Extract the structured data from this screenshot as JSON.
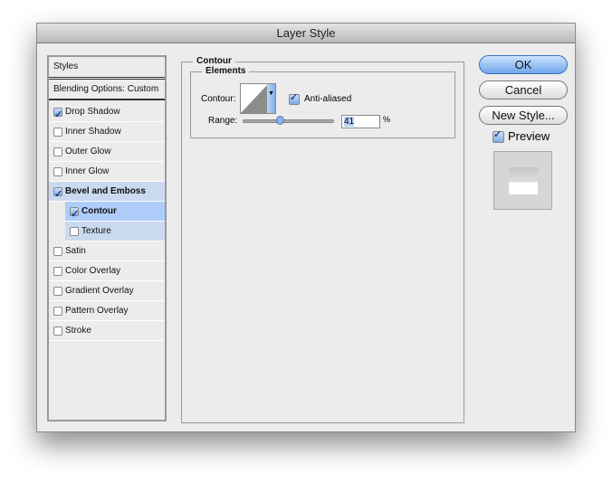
{
  "window": {
    "title": "Layer Style"
  },
  "sidebar": {
    "header": "Styles",
    "blending": "Blending Options: Custom",
    "items": [
      {
        "label": "Drop Shadow",
        "checked": true
      },
      {
        "label": "Inner Shadow",
        "checked": false
      },
      {
        "label": "Outer Glow",
        "checked": false
      },
      {
        "label": "Inner Glow",
        "checked": false
      },
      {
        "label": "Bevel and Emboss",
        "checked": true,
        "bold": true
      },
      {
        "label": "Contour",
        "checked": true,
        "bold": true,
        "indent": true,
        "selected": true
      },
      {
        "label": "Texture",
        "checked": false,
        "indent": true
      },
      {
        "label": "Satin",
        "checked": false
      },
      {
        "label": "Color Overlay",
        "checked": false
      },
      {
        "label": "Gradient Overlay",
        "checked": false
      },
      {
        "label": "Pattern Overlay",
        "checked": false
      },
      {
        "label": "Stroke",
        "checked": false
      }
    ]
  },
  "main": {
    "section": "Contour",
    "group": "Elements",
    "contour_label": "Contour:",
    "anti_aliased": "Anti-aliased",
    "anti_aliased_checked": true,
    "range_label": "Range:",
    "range_value": "41",
    "range_unit": "%"
  },
  "buttons": {
    "ok": "OK",
    "cancel": "Cancel",
    "new_style": "New Style..."
  },
  "preview": {
    "label": "Preview",
    "checked": true
  }
}
